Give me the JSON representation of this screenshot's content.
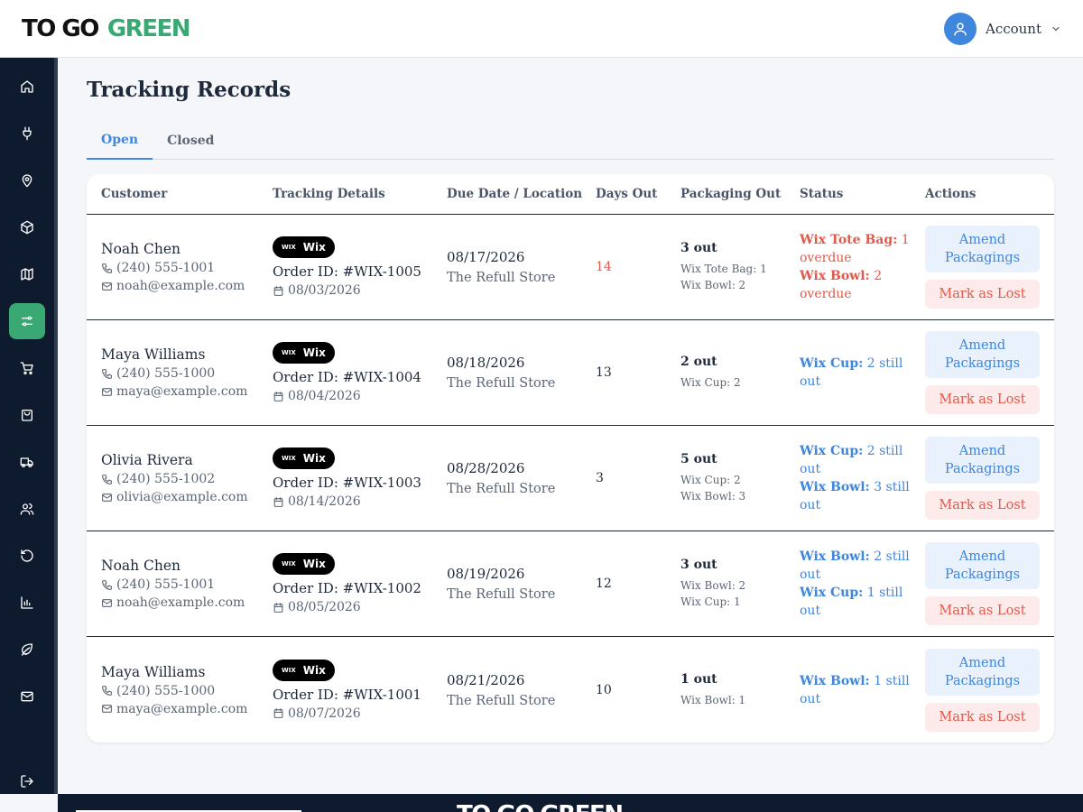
{
  "brand": {
    "part1": "TO GO",
    "part2": "GREEN"
  },
  "account": {
    "label": "Account"
  },
  "page": {
    "title": "Tracking Records"
  },
  "tabs": [
    {
      "label": "Open"
    },
    {
      "label": "Closed"
    }
  ],
  "columns": [
    "Customer",
    "Tracking Details",
    "Due Date / Location",
    "Days Out",
    "Packaging Out",
    "Status",
    "Actions"
  ],
  "actions": {
    "amend": "Amend Packagings",
    "lost": "Mark as Lost"
  },
  "badge": {
    "small": "WIX",
    "label": "Wix"
  },
  "rows": [
    {
      "name": "Noah Chen",
      "phone": "(240) 555-1001",
      "email": "noah@example.com",
      "order_id": "Order ID: #WIX-1005",
      "order_date": "08/03/2026",
      "due_date": "08/17/2026",
      "location": "The Refull Store",
      "days_out": "14",
      "pack_total": "3 out",
      "pack_items": [
        "Wix Tote Bag: 1",
        "Wix Bowl: 2"
      ]
    },
    {
      "name": "Maya Williams",
      "phone": "(240) 555-1000",
      "email": "maya@example.com",
      "order_id": "Order ID: #WIX-1004",
      "order_date": "08/04/2026",
      "due_date": "08/18/2026",
      "location": "The Refull Store",
      "days_out": "13",
      "pack_total": "2 out",
      "pack_items": [
        "Wix Cup: 2"
      ]
    },
    {
      "name": "Olivia Rivera",
      "phone": "(240) 555-1002",
      "email": "olivia@example.com",
      "order_id": "Order ID: #WIX-1003",
      "order_date": "08/14/2026",
      "due_date": "08/28/2026",
      "location": "The Refull Store",
      "days_out": "3",
      "pack_total": "5 out",
      "pack_items": [
        "Wix Cup: 2",
        "Wix Bowl: 3"
      ]
    },
    {
      "name": "Noah Chen",
      "phone": "(240) 555-1001",
      "email": "noah@example.com",
      "order_id": "Order ID: #WIX-1002",
      "order_date": "08/05/2026",
      "due_date": "08/19/2026",
      "location": "The Refull Store",
      "days_out": "12",
      "pack_total": "3 out",
      "pack_items": [
        "Wix Bowl: 2",
        "Wix Cup: 1"
      ]
    },
    {
      "name": "Maya Williams",
      "phone": "(240) 555-1000",
      "email": "maya@example.com",
      "order_id": "Order ID: #WIX-1001",
      "order_date": "08/07/2026",
      "due_date": "08/21/2026",
      "location": "The Refull Store",
      "days_out": "10",
      "pack_total": "1 out",
      "pack_items": [
        "Wix Bowl: 1"
      ]
    }
  ],
  "statuses": [
    [
      {
        "item": "Wix Tote Bag:",
        "text": "1 overdue"
      },
      {
        "item": "Wix Bowl:",
        "text": "2 overdue"
      }
    ],
    [
      {
        "item": "Wix Cup:",
        "text": "2 still out"
      }
    ],
    [
      {
        "item": "Wix Cup:",
        "text": "2 still out"
      },
      {
        "item": "Wix Bowl:",
        "text": "3 still out"
      }
    ],
    [
      {
        "item": "Wix Bowl:",
        "text": "2 still out"
      },
      {
        "item": "Wix Cup:",
        "text": "1 still out"
      }
    ],
    [
      {
        "item": "Wix Bowl:",
        "text": "1 still out"
      }
    ]
  ],
  "colors": {
    "sidebar": "#0e1a2e",
    "brand_green": "#3aa872",
    "accent_blue": "#3f86dd",
    "danger_red": "#e05a4b"
  },
  "icons": {
    "sidebar": [
      "home-icon",
      "plug-icon",
      "map-pin-icon",
      "package-icon",
      "map-icon",
      "tracking-icon",
      "cart-icon",
      "bag-icon",
      "truck-icon",
      "users-icon",
      "return-icon",
      "chart-icon",
      "leaf-icon",
      "mail-icon"
    ],
    "logout": "logout-icon"
  }
}
